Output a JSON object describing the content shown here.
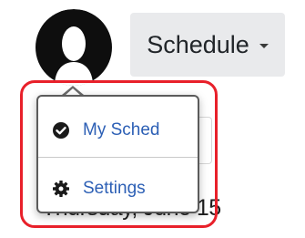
{
  "header": {
    "schedule_label": "Schedule",
    "avatar_icon": "user-silhouette-icon",
    "caret_icon": "caret-down-icon"
  },
  "background": {
    "date_text": "Thursday, June 15"
  },
  "user_menu": {
    "items": [
      {
        "label": "My Sched",
        "icon": "check-circle-icon"
      },
      {
        "label": "Settings",
        "icon": "gear-icon"
      }
    ]
  },
  "colors": {
    "link_blue": "#2c5fb5",
    "highlight_red": "#e8202a",
    "button_gray": "#e9eaec"
  }
}
